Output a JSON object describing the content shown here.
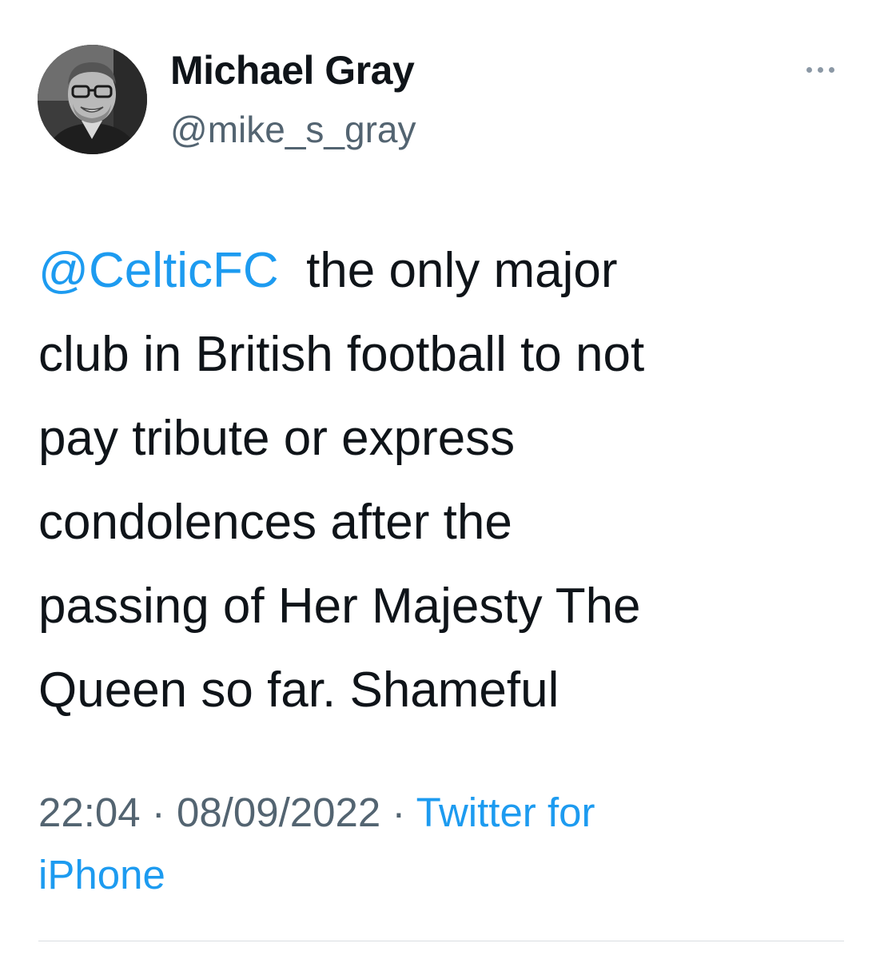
{
  "author": {
    "display_name": "Michael Gray",
    "handle": "@mike_s_gray"
  },
  "tweet": {
    "mention": "@CelticFC",
    "line1_rest": "the only major",
    "line2": "club in British football to not",
    "line3": "pay tribute or express",
    "line4": "condolences after the",
    "line5": "passing of Her Majesty The",
    "line6": "Queen so far. Shameful"
  },
  "meta": {
    "time": "22:04",
    "separator": "·",
    "date": "08/09/2022",
    "source_line1": "Twitter for",
    "source_line2": "iPhone"
  },
  "icons": {
    "more": "more-options-icon"
  },
  "colors": {
    "link": "#1d9bf0",
    "text": "#0f1419",
    "secondary": "#536471",
    "background": "#ffffff",
    "divider": "#d9dde1"
  }
}
